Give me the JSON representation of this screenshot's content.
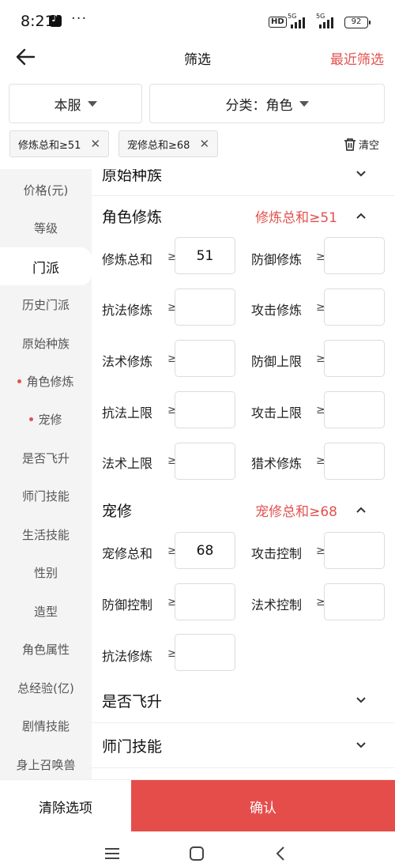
{
  "status": {
    "time": "8:21",
    "more": "···",
    "hd": "HD",
    "net1": "5G",
    "net2": "5G",
    "battery": "92"
  },
  "nav": {
    "title": "筛选",
    "recent": "最近筛选"
  },
  "filters": {
    "server": "本服",
    "category": "分类：角色",
    "chips": [
      "修炼总和≥51",
      "宠修总和≥68"
    ],
    "chip_close": "✕",
    "clear_all": "清空"
  },
  "sidebar": {
    "items": [
      {
        "label": "价格(元)",
        "active": false,
        "dot": false
      },
      {
        "label": "等级",
        "active": false,
        "dot": false
      },
      {
        "label": "门派",
        "active": true,
        "dot": false
      },
      {
        "label": "历史门派",
        "active": false,
        "dot": false
      },
      {
        "label": "原始种族",
        "active": false,
        "dot": false
      },
      {
        "label": "角色修炼",
        "active": false,
        "dot": true
      },
      {
        "label": "宠修",
        "active": false,
        "dot": true
      },
      {
        "label": "是否飞升",
        "active": false,
        "dot": false
      },
      {
        "label": "师门技能",
        "active": false,
        "dot": false
      },
      {
        "label": "生活技能",
        "active": false,
        "dot": false
      },
      {
        "label": "性别",
        "active": false,
        "dot": false
      },
      {
        "label": "造型",
        "active": false,
        "dot": false
      },
      {
        "label": "角色属性",
        "active": false,
        "dot": false
      },
      {
        "label": "总经验(亿)",
        "active": false,
        "dot": false
      },
      {
        "label": "剧情技能",
        "active": false,
        "dot": false
      },
      {
        "label": "身上召唤兽",
        "active": false,
        "dot": false
      }
    ]
  },
  "main": {
    "partial_section": "原始种族",
    "ge": "≥",
    "cultivation": {
      "title": "角色修炼",
      "summary": "修炼总和≥51",
      "fields": [
        {
          "label": "修炼总和",
          "value": "51"
        },
        {
          "label": "防御修炼",
          "value": ""
        },
        {
          "label": "抗法修炼",
          "value": ""
        },
        {
          "label": "攻击修炼",
          "value": ""
        },
        {
          "label": "法术修炼",
          "value": ""
        },
        {
          "label": "防御上限",
          "value": ""
        },
        {
          "label": "抗法上限",
          "value": ""
        },
        {
          "label": "攻击上限",
          "value": ""
        },
        {
          "label": "法术上限",
          "value": ""
        },
        {
          "label": "猎术修炼",
          "value": ""
        }
      ]
    },
    "pet": {
      "title": "宠修",
      "summary": "宠修总和≥68",
      "fields": [
        {
          "label": "宠修总和",
          "value": "68"
        },
        {
          "label": "攻击控制",
          "value": ""
        },
        {
          "label": "防御控制",
          "value": ""
        },
        {
          "label": "法术控制",
          "value": ""
        },
        {
          "label": "抗法修炼",
          "value": ""
        }
      ]
    },
    "ascension": {
      "title": "是否飞升"
    },
    "school_skills": {
      "title": "师门技能"
    }
  },
  "bottom": {
    "clear": "清除选项",
    "confirm": "确认"
  }
}
